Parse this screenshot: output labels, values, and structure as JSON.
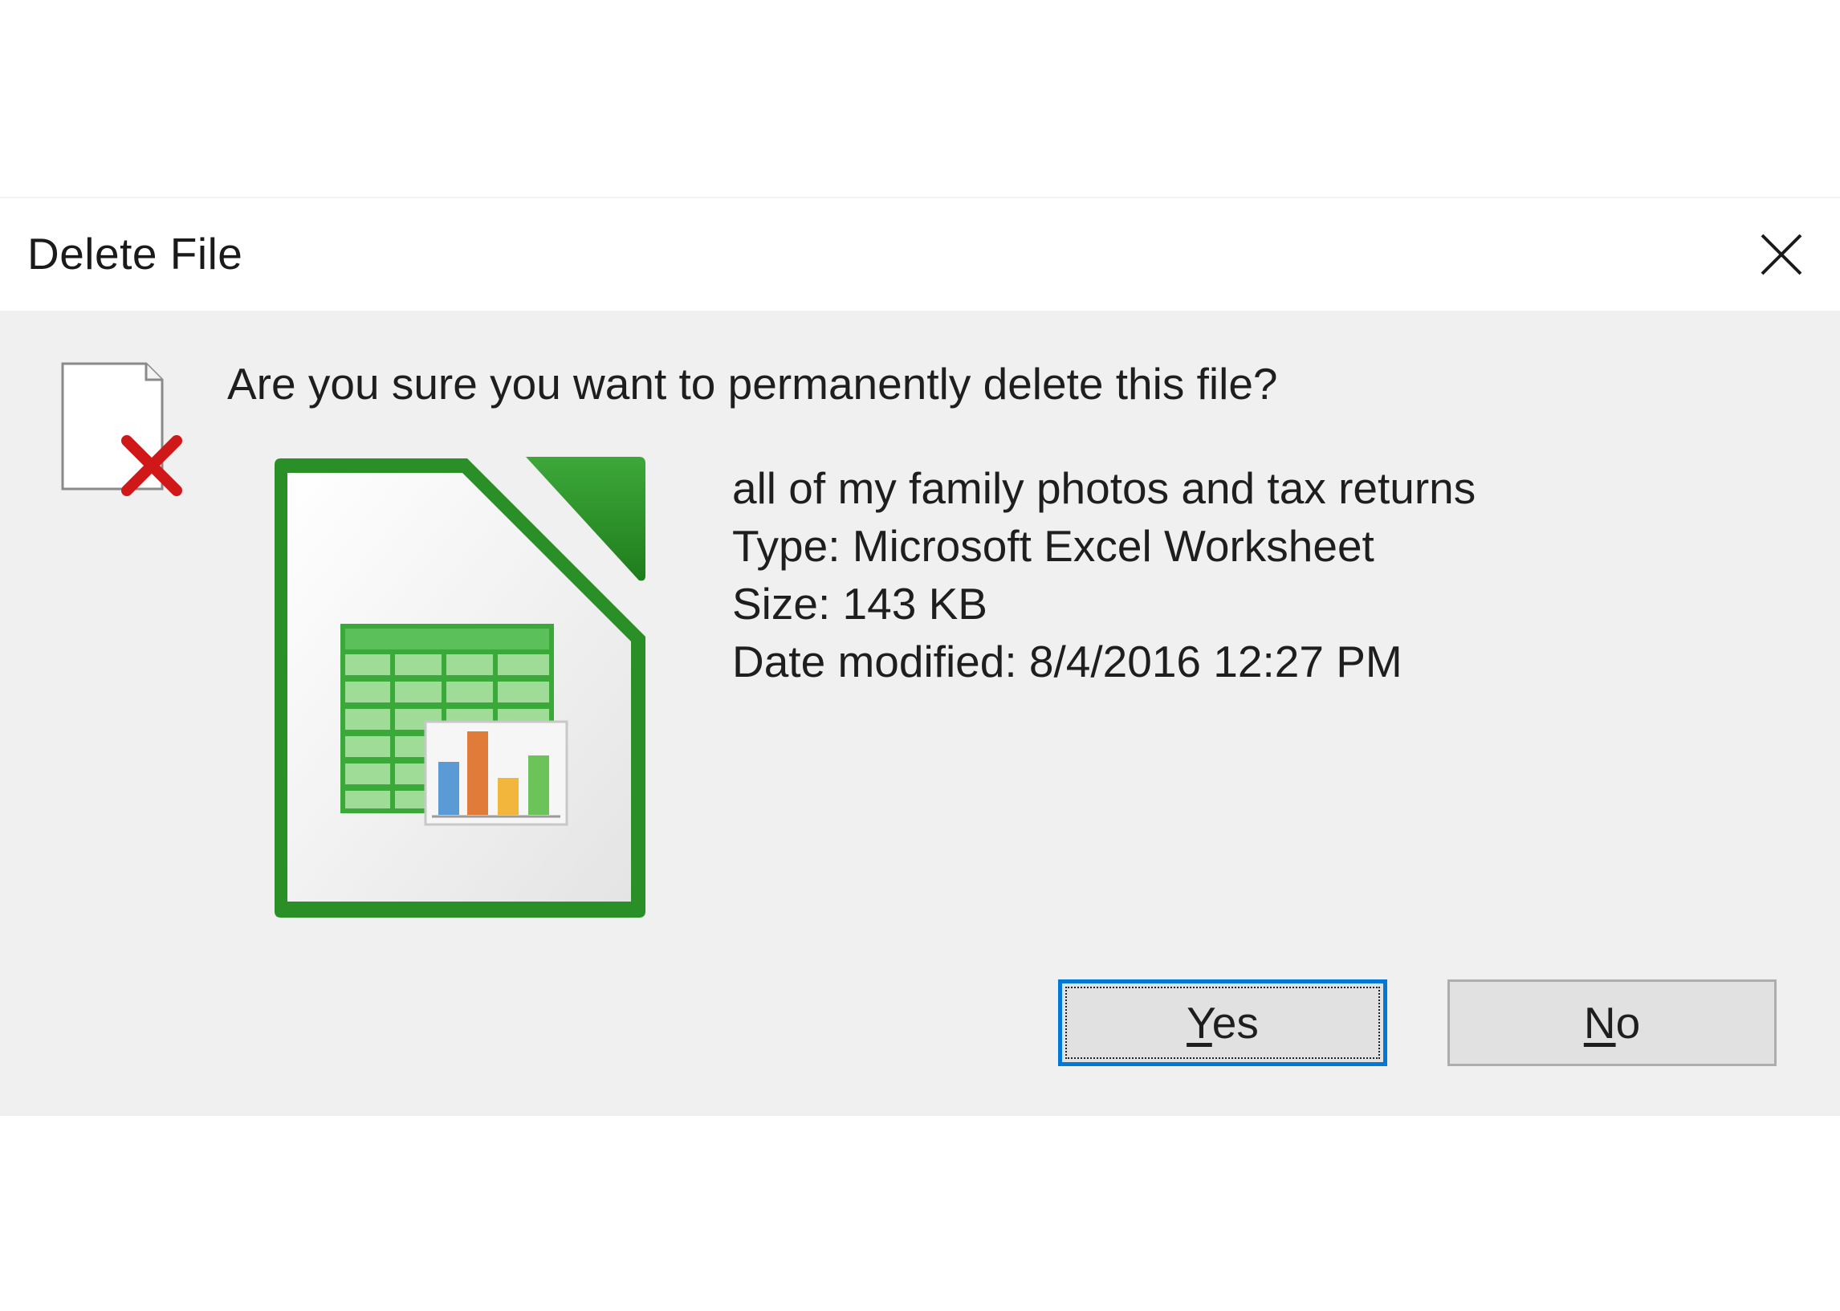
{
  "dialog": {
    "title": "Delete File",
    "close_icon": "close-icon",
    "question": "Are you sure you want to permanently delete this file?",
    "file": {
      "name": "all of my family photos and tax returns",
      "type_line": "Type: Microsoft Excel Worksheet",
      "size_line": "Size: 143 KB",
      "date_line": "Date modified: 8/4/2016 12:27 PM",
      "icon": "spreadsheet-file-icon"
    },
    "buttons": {
      "yes_accel": "Y",
      "yes_rest": "es",
      "no_accel": "N",
      "no_rest": "o"
    },
    "colors": {
      "accent": "#0078d7",
      "icon_green": "#2e9a2a",
      "delete_red": "#d01818"
    }
  }
}
